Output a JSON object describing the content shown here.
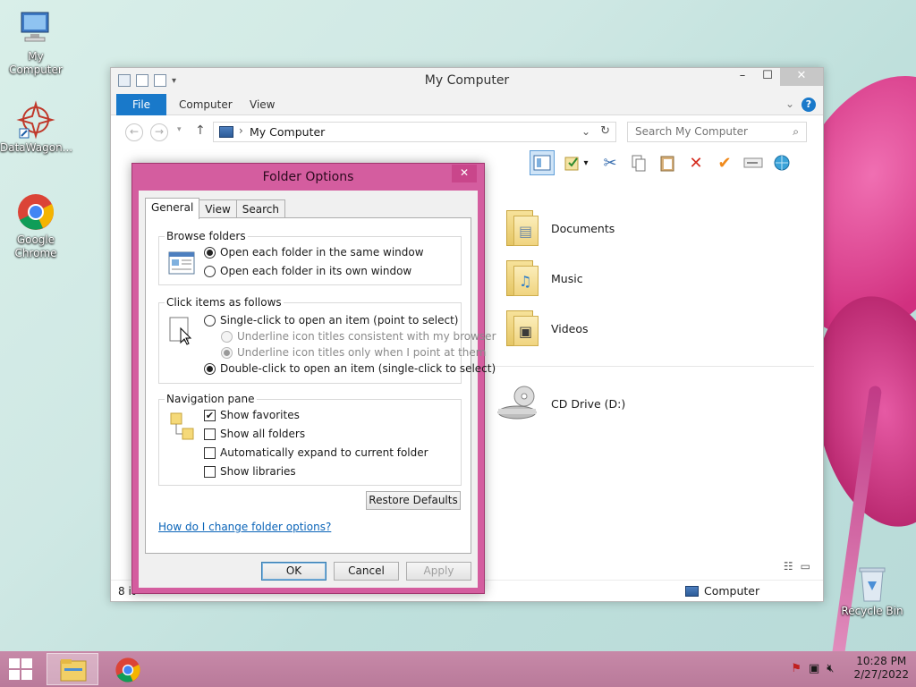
{
  "desktop": {
    "icons": [
      {
        "label": "My Computer"
      },
      {
        "label": "DataWagon..."
      },
      {
        "label": "Google Chrome"
      },
      {
        "label": "Recycle Bin"
      }
    ]
  },
  "explorer": {
    "title": "My Computer",
    "ribbon_tabs": [
      "File",
      "Computer",
      "View"
    ],
    "address": "My Computer",
    "search_placeholder": "Search My Computer",
    "items": [
      {
        "name": "Documents",
        "icon": "documents-folder-icon"
      },
      {
        "name": "Music",
        "icon": "music-folder-icon"
      },
      {
        "name": "Videos",
        "icon": "videos-folder-icon"
      },
      {
        "name": "CD Drive (D:)",
        "icon": "cd-drive-icon"
      }
    ],
    "status_count": "8 it",
    "status_location": "Computer"
  },
  "dialog": {
    "title": "Folder Options",
    "close_glyph": "✕",
    "tabs": [
      "General",
      "View",
      "Search"
    ],
    "browse_folders": {
      "title": "Browse folders",
      "options": [
        {
          "label": "Open each folder in the same window",
          "checked": true
        },
        {
          "label": "Open each folder in its own window",
          "checked": false
        }
      ]
    },
    "click_items": {
      "title": "Click items as follows",
      "single": "Single-click to open an item (point to select)",
      "underline_browser": "Underline icon titles consistent with my browser",
      "underline_point": "Underline icon titles only when I point at them",
      "double": "Double-click to open an item (single-click to select)"
    },
    "navigation_pane": {
      "title": "Navigation pane",
      "options": [
        {
          "label": "Show favorites",
          "checked": true
        },
        {
          "label": "Show all folders",
          "checked": false
        },
        {
          "label": "Automatically expand to current folder",
          "checked": false
        },
        {
          "label": "Show libraries",
          "checked": false
        }
      ]
    },
    "restore_defaults": "Restore Defaults",
    "help_link": "How do I change folder options?",
    "buttons": {
      "ok": "OK",
      "cancel": "Cancel",
      "apply": "Apply"
    }
  },
  "taskbar": {
    "time": "10:28 PM",
    "date": "2/27/2022"
  }
}
